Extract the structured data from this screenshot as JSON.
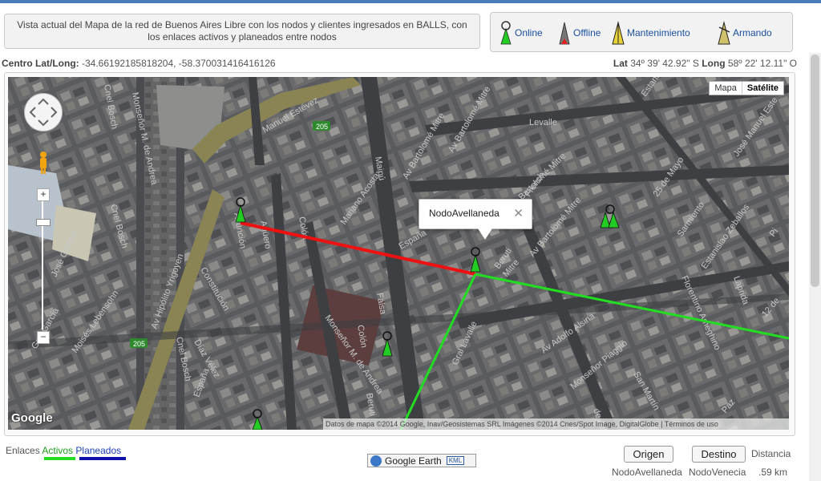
{
  "header": {
    "description": "Vista actual del Mapa de la red de Buenos Aires Libre con los nodos y clientes ingresados en BALLS, con los enlaces activos y planeados entre nodos"
  },
  "legend": {
    "online": "Online",
    "offline": "Offline",
    "mantenimiento": "Mantenimiento",
    "armando": "Armando"
  },
  "center": {
    "label": "Centro Lat/Long:",
    "value": "-34.66192185818204, -58.370031416416126"
  },
  "latlong": {
    "lat_label": "Lat",
    "lat_value": "34º 39' 42.92\" S",
    "long_label": "Long",
    "long_value": "58º 22' 12.11\" O"
  },
  "map": {
    "type_map": "Mapa",
    "type_satellite": "Satélite",
    "google_logo": "Google",
    "attribution": "Datos de mapa ©2014 Google, Inav/Geosistemas SRL Imágenes ©2014 Cnes/Spot Image, DigitalGlobe  |  Términos de uso",
    "popup_title": "NodoAvellaneda",
    "road_badges": [
      "205",
      "205"
    ],
    "streets": [
      "Manuel Estévez",
      "Av Bartolomé Mitre",
      "Levalle",
      "Estanislao Zeballos",
      "French",
      "José Manuel Este",
      "Av Bartolomé Mitre",
      "Mariano Acosta",
      "Maipú",
      "25 de Mayo",
      "Sarmiento",
      "Estanislao Zeballos",
      "Pi",
      "Monseñor M. de Andrea",
      "Cnel Bosch",
      "Asunción",
      "Colón",
      "Av Bartolomé Mitre",
      "Florentino Ameghino",
      "Laprida",
      "12 de",
      "Av Hipólito Yrigoyen",
      "Constitución",
      "España",
      "Beruti",
      "Av Bartolomé Mitre",
      "Av Adolfo Alsina",
      "Monseñor Piaggio",
      "San Martín",
      "Gral Lavalle",
      "Paz",
      "Cnel Bosch",
      "Díaz Vélez",
      "España",
      "Colón",
      "Monseñor M. de Andrea",
      "Beruti",
      "José Gibone",
      "Moisés Lebensohn",
      "Gral García",
      "Cnel Bosch",
      "Agüero",
      "Falsa",
      "Mitre",
      "de Julio"
    ]
  },
  "links": {
    "label": "Enlaces",
    "active": "Activos",
    "planned": "Planeados"
  },
  "google_earth": {
    "label": "Google Earth",
    "badge": "KML"
  },
  "route": {
    "origin_button": "Origen",
    "destination_button": "Destino",
    "distance_label": "Distancia",
    "origin_value": "NodoAvellaneda",
    "destination_value": "NodoVenecia",
    "distance_value": ".59 km"
  },
  "colors": {
    "online": "#22cc22",
    "offline": "#e02020",
    "active_link": "#22dd22",
    "planned_link": "#1111aa"
  }
}
